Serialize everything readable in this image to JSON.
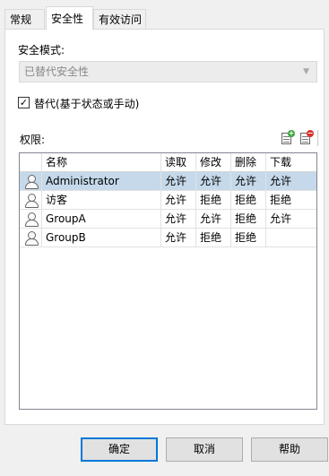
{
  "tabs": [
    {
      "label": "常规"
    },
    {
      "label": "安全性"
    },
    {
      "label": "有效访问"
    }
  ],
  "security_mode": {
    "label": "安全模式:",
    "value": "已替代安全性"
  },
  "override_checkbox": {
    "label": "替代(基于状态或手动)",
    "checked": true
  },
  "permissions": {
    "label": "权限:",
    "toolbar": [
      {
        "icon": "add-permission-icon"
      },
      {
        "icon": "remove-permission-icon"
      }
    ],
    "columns": [
      "名称",
      "读取",
      "修改",
      "删除",
      "下载"
    ],
    "rows": [
      {
        "name": "Administrator",
        "read": "允许",
        "modify": "允许",
        "delete": "允许",
        "download": "允许",
        "selected": true
      },
      {
        "name": "访客",
        "read": "允许",
        "modify": "拒绝",
        "delete": "拒绝",
        "download": "拒绝",
        "selected": false
      },
      {
        "name": "GroupA",
        "read": "允许",
        "modify": "允许",
        "delete": "拒绝",
        "download": "允许",
        "selected": false
      },
      {
        "name": "GroupB",
        "read": "允许",
        "modify": "拒绝",
        "delete": "拒绝",
        "download": "",
        "selected": false
      }
    ]
  },
  "buttons": {
    "ok": "确定",
    "cancel": "取消",
    "help": "帮助"
  },
  "colors": {
    "selected_row": "#c5d9ea",
    "default_button_border": "#0078d7"
  }
}
